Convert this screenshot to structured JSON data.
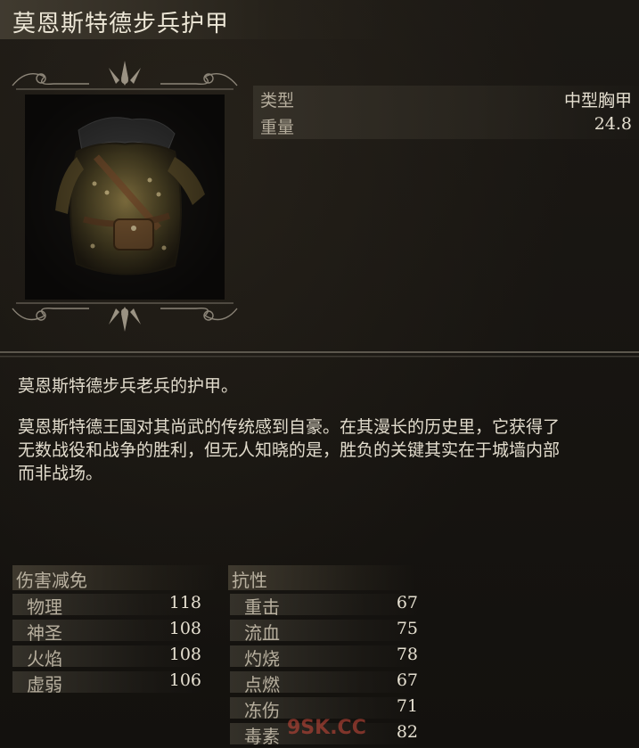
{
  "item": {
    "name": "莫恩斯特德步兵护甲",
    "attributes": [
      {
        "label": "类型",
        "value": "中型胸甲"
      },
      {
        "label": "重量",
        "value": "24.8"
      }
    ]
  },
  "description": {
    "line1": "莫恩斯特德步兵老兵的护甲。",
    "paragraph": [
      " 莫恩斯特德王国对其尚武的传统感到自豪。在其漫长的历史里，它获得了",
      "无数战役和战争的胜利，但无人知晓的是，胜负的关键其实在于城墙内部",
      "而非战场。"
    ]
  },
  "damage_reduction": {
    "header": "伤害减免",
    "rows": [
      {
        "label": "物理",
        "value": "118"
      },
      {
        "label": "神圣",
        "value": "108"
      },
      {
        "label": "火焰",
        "value": "108"
      },
      {
        "label": "虚弱",
        "value": "106"
      }
    ]
  },
  "resistance": {
    "header": "抗性",
    "rows": [
      {
        "label": "重击",
        "value": "67"
      },
      {
        "label": "流血",
        "value": "75"
      },
      {
        "label": "灼烧",
        "value": "78"
      },
      {
        "label": "点燃",
        "value": "67"
      },
      {
        "label": "冻伤",
        "value": "71"
      },
      {
        "label": "毒素",
        "value": "82"
      }
    ]
  },
  "watermark": {
    "text": "9SK.CC"
  },
  "colors": {
    "background": "#15130f",
    "text_primary": "#e2dccd",
    "text_label": "#b7af9e",
    "watermark": "#d24a3c"
  }
}
